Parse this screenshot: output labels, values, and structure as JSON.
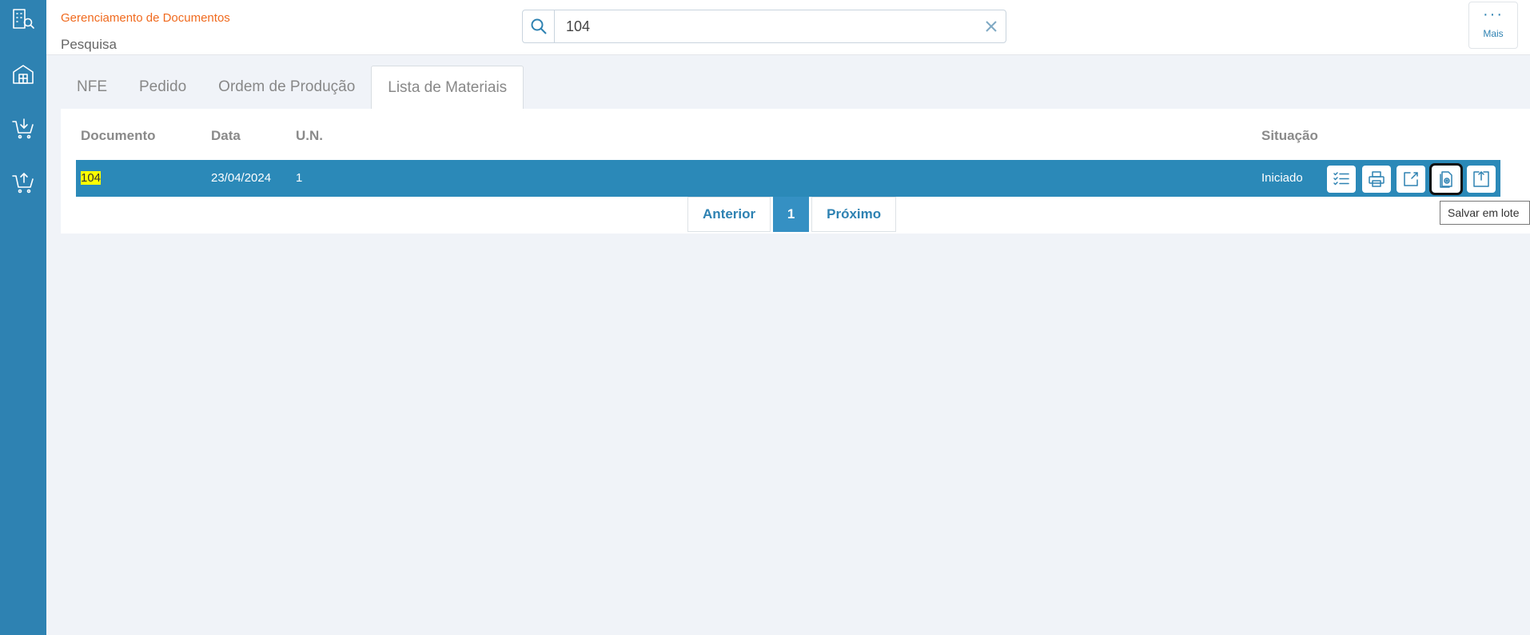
{
  "header": {
    "app_title": "Gerenciamento de Documentos",
    "page_title": "Pesquisa",
    "search": {
      "value": "104"
    },
    "more_label": "Mais",
    "more_dots": "···"
  },
  "sidebar": {
    "items": [
      {
        "icon": "building-search-icon"
      },
      {
        "icon": "warehouse-icon"
      },
      {
        "icon": "cart-download-icon"
      },
      {
        "icon": "cart-upload-icon"
      }
    ]
  },
  "tabs": [
    {
      "label": "NFE",
      "active": false
    },
    {
      "label": "Pedido",
      "active": false
    },
    {
      "label": "Ordem de Produção",
      "active": false
    },
    {
      "label": "Lista de Materiais",
      "active": true
    }
  ],
  "table": {
    "columns": {
      "documento": "Documento",
      "data": "Data",
      "un": "U.N.",
      "situacao": "Situação"
    },
    "rows": [
      {
        "documento": "104",
        "data": "23/04/2024",
        "un": "1",
        "situacao": "Iniciado"
      }
    ],
    "actions": [
      {
        "icon": "checklist-icon"
      },
      {
        "icon": "printer-icon"
      },
      {
        "icon": "edit-export-icon"
      },
      {
        "icon": "batch-save-icon",
        "focused": true
      },
      {
        "icon": "upload-box-icon"
      }
    ]
  },
  "pagination": {
    "prev": "Anterior",
    "current": "1",
    "next": "Próximo"
  },
  "tooltip": "Salvar em lote",
  "colors": {
    "accent": "#2e82b2",
    "title_orange": "#f06a1e",
    "row_highlight": "#2b89b8",
    "search_highlight": "#ffff00"
  }
}
